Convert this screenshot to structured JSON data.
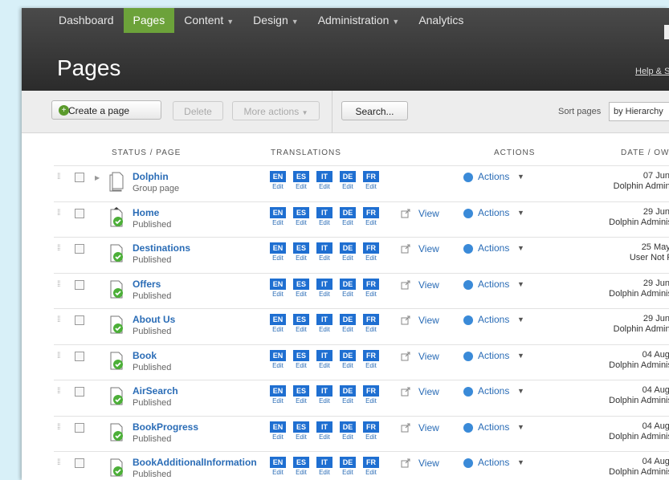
{
  "nav": {
    "items": [
      {
        "label": "Dashboard",
        "active": false,
        "dropdown": false
      },
      {
        "label": "Pages",
        "active": true,
        "dropdown": false
      },
      {
        "label": "Content",
        "active": false,
        "dropdown": true
      },
      {
        "label": "Design",
        "active": false,
        "dropdown": true
      },
      {
        "label": "Administration",
        "active": false,
        "dropdown": true
      },
      {
        "label": "Analytics",
        "active": false,
        "dropdown": false
      }
    ]
  },
  "header": {
    "title": "Pages",
    "help_link": "Help & S"
  },
  "toolbar": {
    "create_label": "Create a page",
    "delete_label": "Delete",
    "more_label": "More actions",
    "search_label": "Search...",
    "sort_label": "Sort pages",
    "sort_value": "by Hierarchy"
  },
  "table": {
    "headers": {
      "status_page": "STATUS / PAGE",
      "translations": "TRANSLATIONS",
      "actions": "ACTIONS",
      "date_owner": "DATE / OW"
    },
    "edit_label": "Edit",
    "view_label": "View",
    "actions_label": "Actions",
    "languages": [
      "EN",
      "ES",
      "IT",
      "DE",
      "FR"
    ],
    "rows": [
      {
        "name": "Dolphin",
        "status": "Group page",
        "type": "group",
        "date": "07 Jun,",
        "owner": "Dolphin Admini",
        "view": false
      },
      {
        "name": "Home",
        "status": "Published",
        "type": "home",
        "date": "29 Jun,",
        "owner": "Dolphin Adminis",
        "view": true
      },
      {
        "name": "Destinations",
        "status": "Published",
        "type": "page",
        "date": "25 May,",
        "owner": "User Not F",
        "view": true
      },
      {
        "name": "Offers",
        "status": "Published",
        "type": "page",
        "date": "29 Jun,",
        "owner": "Dolphin Adminis",
        "view": true
      },
      {
        "name": "About Us",
        "status": "Published",
        "type": "page",
        "date": "29 Jun,",
        "owner": "Dolphin Admini",
        "view": true
      },
      {
        "name": "Book",
        "status": "Published",
        "type": "page",
        "date": "04 Aug,",
        "owner": "Dolphin Adminis",
        "view": true
      },
      {
        "name": "AirSearch",
        "status": "Published",
        "type": "page",
        "date": "04 Aug,",
        "owner": "Dolphin Adminis",
        "view": true
      },
      {
        "name": "BookProgress",
        "status": "Published",
        "type": "page",
        "date": "04 Aug,",
        "owner": "Dolphin Adminis",
        "view": true
      },
      {
        "name": "BookAdditionalInformation",
        "status": "Published",
        "type": "page",
        "date": "04 Aug,",
        "owner": "Dolphin Adminis",
        "view": true
      }
    ]
  },
  "colors": {
    "nav_active": "#6ca23a",
    "translation_badge": "#1f6fd1",
    "link": "#2a6cb6",
    "published": "#4caf38"
  }
}
